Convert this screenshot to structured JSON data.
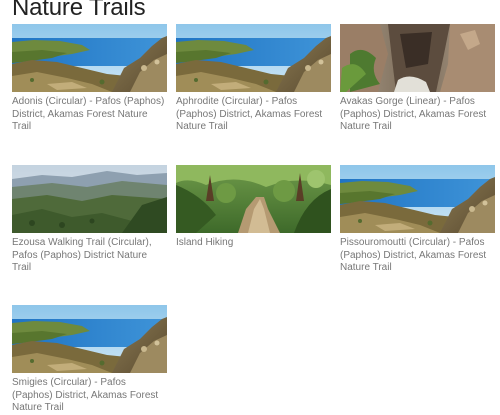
{
  "page": {
    "title": "Nature Trails"
  },
  "trails": [
    {
      "name": "Adonis (Circular) - Pafos (Paphos) District, Akamas Forest Nature Trail",
      "image": "coastal-cliffs"
    },
    {
      "name": "Aphrodite (Circular) - Pafos (Paphos) District, Akamas Forest Nature Trail",
      "image": "coastal-cliffs"
    },
    {
      "name": "Avakas Gorge (Linear) - Pafos (Paphos) District, Akamas Forest Nature Trail",
      "image": "rocky-gorge"
    },
    {
      "name": "Ezousa Walking Trail (Circular), Pafos (Paphos) District Nature Trail",
      "image": "mountain-valley"
    },
    {
      "name": "Island Hiking",
      "image": "forest-path"
    },
    {
      "name": "Pissouromoutti (Circular) - Pafos (Paphos) District, Akamas Forest Nature Trail",
      "image": "coastal-cliffs"
    },
    {
      "name": "Smigies (Circular) - Pafos (Paphos) District, Akamas Forest Nature Trail",
      "image": "coastal-cliffs"
    }
  ],
  "colors": {
    "caption": "#777777",
    "title": "#222222",
    "background": "#ffffff"
  }
}
